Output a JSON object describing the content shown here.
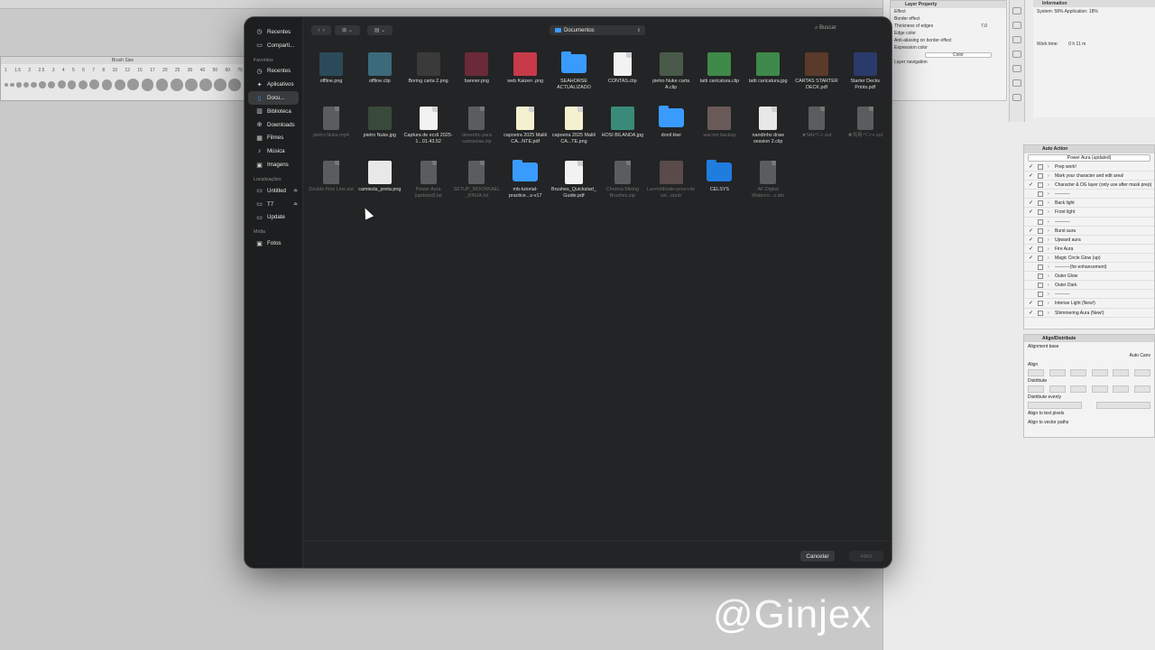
{
  "background": {
    "brush_panel": {
      "title": "Brush Size",
      "sizes": [
        "1",
        "1.5",
        "2",
        "2.5",
        "3",
        "4",
        "5",
        "6",
        "7",
        "8",
        "10",
        "12",
        "15",
        "17",
        "20",
        "25",
        "30",
        "40",
        "50",
        "60",
        "70"
      ]
    },
    "layer_property": {
      "title": "Layer Property",
      "effect_label": "Effect",
      "border_effect": "Border effect",
      "thickness": "Thickness of edges",
      "thickness_value": "7.0",
      "edge_color": "Edge color",
      "anti_alias": "Anti-aliasing on border effect",
      "expression_color": "Expression color",
      "color_value": "Color",
      "layer_navigation": "Layer navigation"
    },
    "information": {
      "title": "Information",
      "system_label": "System:",
      "system_value": "58%",
      "application_label": "Application:",
      "application_value": "18%",
      "work_time_label": "Work time:",
      "work_time_value": "0 h 11 m"
    },
    "auto_action": {
      "title": "Auto Action",
      "selected_set": "Power Aura (updated)",
      "items": [
        "Prep work!",
        "Mark your character and edit area!",
        "Character & DG layer (only use after mask prep)",
        "----------",
        "Back light",
        "Front light",
        "----------",
        "Burst aura",
        "Upward aura",
        "Fire Aura",
        "Magic Circle Glow (up)",
        "----------(for enhancement)",
        "Outer Glow",
        "Outer Dark",
        "----------",
        "Intense Light (New!)",
        "Shimmering Aura (New!)"
      ]
    },
    "align": {
      "title": "Align/Distribute",
      "alignment_base": "Alignment base",
      "auto_label": "Auto",
      "canvas_label": "Canv",
      "align_label": "Align",
      "distribute_label": "Distribute",
      "distribute_evenly": "Distribute evenly",
      "align_text_pixels": "Align to text pixels",
      "align_vector": "Align to vector paths"
    },
    "watermark": "@Ginjex"
  },
  "dialog": {
    "path_folder": "Documentos",
    "search_placeholder": "Buscar",
    "cancel_label": "Cancelar",
    "open_label": "Abrir",
    "sidebar": {
      "top_items": [
        {
          "label": "Recentes",
          "icon": "clock-icon"
        },
        {
          "label": "Comparti...",
          "icon": "shared-folder-icon"
        }
      ],
      "favorites_header": "Favoritos",
      "favorites": [
        {
          "label": "Recentes",
          "icon": "clock-icon"
        },
        {
          "label": "Aplicativos",
          "icon": "apps-icon"
        },
        {
          "label": "Docu...",
          "icon": "document-icon",
          "selected": true
        },
        {
          "label": "Biblioteca",
          "icon": "library-icon"
        },
        {
          "label": "Downloads",
          "icon": "download-icon"
        },
        {
          "label": "Filmes",
          "icon": "film-icon"
        },
        {
          "label": "Música",
          "icon": "music-icon"
        },
        {
          "label": "Imagens",
          "icon": "image-icon"
        }
      ],
      "locations_header": "Localizações",
      "locations": [
        {
          "label": "Untitled",
          "icon": "drive-icon"
        },
        {
          "label": "T7",
          "icon": "drive-icon"
        },
        {
          "label": "Update",
          "icon": "drive-icon"
        }
      ],
      "media_header": "Mídia",
      "media": [
        {
          "label": "Fotos",
          "icon": "photos-icon"
        }
      ]
    },
    "files": [
      {
        "name": "offline.png",
        "kind": "img",
        "color": "#2a4a5a",
        "dim": false
      },
      {
        "name": "offline.clip",
        "kind": "img",
        "color": "#3b6a7a",
        "dim": false
      },
      {
        "name": "Boring carta 2.png",
        "kind": "img",
        "color": "#3a3a3a",
        "dim": false
      },
      {
        "name": "banner.png",
        "kind": "img",
        "color": "#6a2a3a",
        "dim": false
      },
      {
        "name": "web Kaizen .png",
        "kind": "img",
        "color": "#c83a4a",
        "dim": false
      },
      {
        "name": "SEAHORSE ACTUALIZADO",
        "kind": "folder",
        "color": "#3a9bff",
        "dim": false
      },
      {
        "name": "CONTAS.clip",
        "kind": "doc",
        "color": "#f2f2f2",
        "dim": false
      },
      {
        "name": "pietro Nuke carta A.clip",
        "kind": "img",
        "color": "#4a5a4a",
        "dim": false
      },
      {
        "name": "tatti caricatura.clip",
        "kind": "img",
        "color": "#3f8a4a",
        "dim": false
      },
      {
        "name": "tatti caricatura.jpg",
        "kind": "img",
        "color": "#3f8a4a",
        "dim": false
      },
      {
        "name": "CARTAS STARTER DECK.pdf",
        "kind": "img",
        "color": "#5a3a2a",
        "dim": false
      },
      {
        "name": "Starter Decks Prints.pdf",
        "kind": "img",
        "color": "#2a3a6a",
        "dim": false
      },
      {
        "name": "pietro Nuke.mp4",
        "kind": "gray",
        "color": "#5b5c5e",
        "dim": true
      },
      {
        "name": "pietro Nuke.jpg",
        "kind": "img",
        "color": "#3a4a3a",
        "dim": false
      },
      {
        "name": "Captura de ecrã 2025-1...01.43.52",
        "kind": "doc",
        "color": "#f2f2f2",
        "dim": false
      },
      {
        "name": "desenho para camisolas.zip",
        "kind": "gray",
        "color": "#5b5c5e",
        "dim": true
      },
      {
        "name": "capoeira 2025 Mališ CA...NTE.pdf",
        "kind": "doc",
        "color": "#f5f0d0",
        "dim": false
      },
      {
        "name": "capoeira 2025 Mališ CA...TE.png",
        "kind": "doc",
        "color": "#f5f0d0",
        "dim": false
      },
      {
        "name": "HOSI BILANDA.jpg",
        "kind": "img",
        "color": "#3a8a7a",
        "dim": false
      },
      {
        "name": "donil kiwi",
        "kind": "folder",
        "color": "#3a9bff",
        "dim": false
      },
      {
        "name": "wacom backup",
        "kind": "img",
        "color": "#6a5a5a",
        "dim": true
      },
      {
        "name": "nandinho draw session 2.clip",
        "kind": "doc",
        "color": "#e8e8e8",
        "dim": false
      },
      {
        "name": "★SAIペン.sut",
        "kind": "gray",
        "color": "#5b5c5e",
        "dim": true
      },
      {
        "name": "★共用ペン+.sut",
        "kind": "gray",
        "color": "#5b5c5e",
        "dim": true
      },
      {
        "name": "Double Fine Line.sut",
        "kind": "gray",
        "color": "#5b5c5e",
        "dim": true
      },
      {
        "name": "camisola_preta.png",
        "kind": "img",
        "color": "#e8e8e8",
        "dim": false
      },
      {
        "name": "Power Aura (updated).lat",
        "kind": "gray",
        "color": "#5b5c5e",
        "dim": true
      },
      {
        "name": "SETUP_MOONKAEL_DINJA.txt",
        "kind": "gray",
        "color": "#5b5c5e",
        "dim": true
      },
      {
        "name": "mb-tutorial-practice...s-v17",
        "kind": "folder",
        "color": "#3a9bff",
        "dim": false
      },
      {
        "name": "Brushes_Quickstart_Guide.pdf",
        "kind": "doc",
        "color": "#f2f2f2",
        "dim": false
      },
      {
        "name": "Chroma Mixing Brushes.zip",
        "kind": "gray",
        "color": "#5b5c5e",
        "dim": true
      },
      {
        "name": "La+méthode+pour+dessi...epub",
        "kind": "img",
        "color": "#5a4a4a",
        "dim": true
      },
      {
        "name": "CELSYS",
        "kind": "folder-dark",
        "color": "#1f7de0",
        "dim": false
      },
      {
        "name": "AF Digital Waterco...s.abr",
        "kind": "gray",
        "color": "#5b5c5e",
        "dim": true
      }
    ]
  }
}
